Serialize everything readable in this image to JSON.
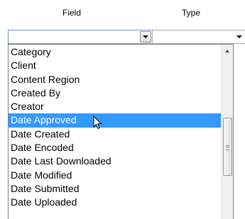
{
  "columns": {
    "field_label": "Field",
    "type_label": "Type"
  },
  "field_select": {
    "value": ""
  },
  "type_select": {
    "value": ""
  },
  "dropdown": {
    "items": [
      "Category",
      "Client",
      "Content Region",
      "Created By",
      "Creator",
      "Date Approved",
      "Date Created",
      "Date Encoded",
      "Date Last Downloaded",
      "Date Modified",
      "Date Submitted",
      "Date Uploaded"
    ],
    "highlighted": "Date Approved"
  },
  "colors": {
    "highlight": "#3399ff"
  },
  "icons": [
    "chevron-down-icon",
    "scroll-up-arrow-icon",
    "mouse-pointer-icon"
  ]
}
